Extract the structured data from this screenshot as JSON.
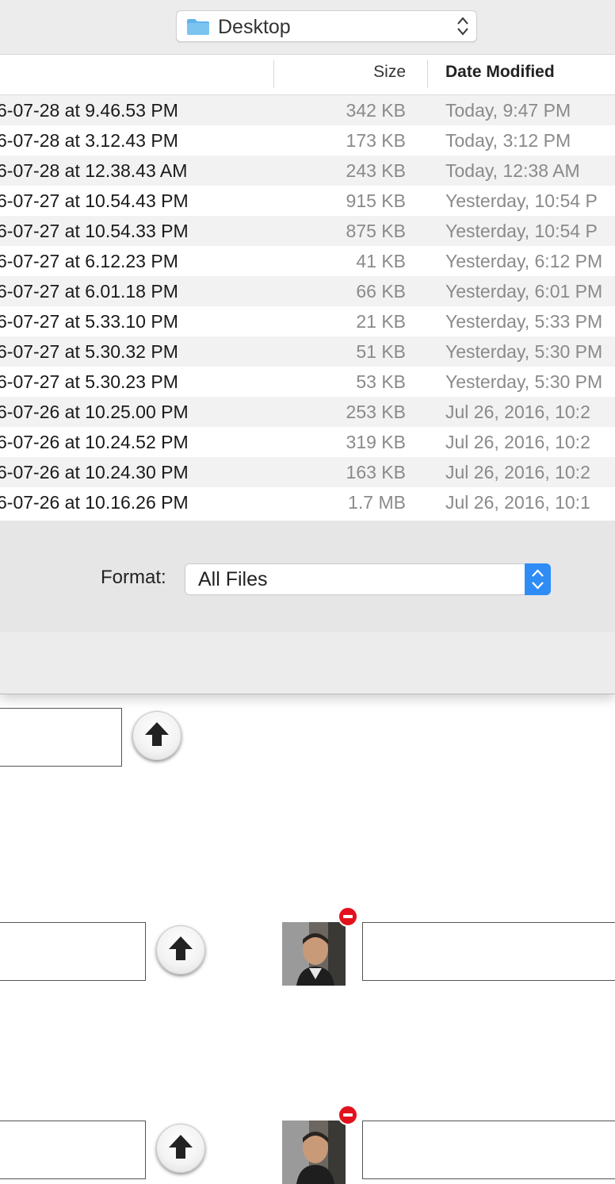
{
  "dialog": {
    "location": "Desktop",
    "columns": {
      "size": "Size",
      "date_modified": "Date Modified"
    },
    "files": [
      {
        "name": "6-07-28 at 9.46.53 PM",
        "size": "342 KB",
        "date": "Today, 9:47 PM"
      },
      {
        "name": "6-07-28 at 3.12.43 PM",
        "size": "173 KB",
        "date": "Today, 3:12 PM"
      },
      {
        "name": "6-07-28 at 12.38.43 AM",
        "size": "243 KB",
        "date": "Today, 12:38 AM"
      },
      {
        "name": "6-07-27 at 10.54.43 PM",
        "size": "915 KB",
        "date": "Yesterday, 10:54 P"
      },
      {
        "name": "6-07-27 at 10.54.33 PM",
        "size": "875 KB",
        "date": "Yesterday, 10:54 P"
      },
      {
        "name": "6-07-27 at 6.12.23 PM",
        "size": "41 KB",
        "date": "Yesterday, 6:12 PM"
      },
      {
        "name": "6-07-27 at 6.01.18 PM",
        "size": "66 KB",
        "date": "Yesterday, 6:01 PM"
      },
      {
        "name": "6-07-27 at 5.33.10 PM",
        "size": "21 KB",
        "date": "Yesterday, 5:33 PM"
      },
      {
        "name": "6-07-27 at 5.30.32 PM",
        "size": "51 KB",
        "date": "Yesterday, 5:30 PM"
      },
      {
        "name": "6-07-27 at 5.30.23 PM",
        "size": "53 KB",
        "date": "Yesterday, 5:30 PM"
      },
      {
        "name": "6-07-26 at 10.25.00 PM",
        "size": "253 KB",
        "date": "Jul 26, 2016, 10:2"
      },
      {
        "name": "6-07-26 at 10.24.52 PM",
        "size": "319 KB",
        "date": "Jul 26, 2016, 10:2"
      },
      {
        "name": "6-07-26 at 10.24.30 PM",
        "size": "163 KB",
        "date": "Jul 26, 2016, 10:2"
      },
      {
        "name": "6-07-26 at 10.16.26 PM",
        "size": "1.7 MB",
        "date": "Jul 26, 2016, 10:1"
      }
    ],
    "format": {
      "label": "Format:",
      "value": "All Files"
    }
  },
  "colors": {
    "accent": "#2f8cf5",
    "remove": "#e2121c",
    "folder": "#5fb4ea"
  },
  "icons": [
    "folder-icon",
    "up-down-arrows-icon",
    "upload-arrow-icon",
    "remove-icon",
    "avatar-photo"
  ]
}
